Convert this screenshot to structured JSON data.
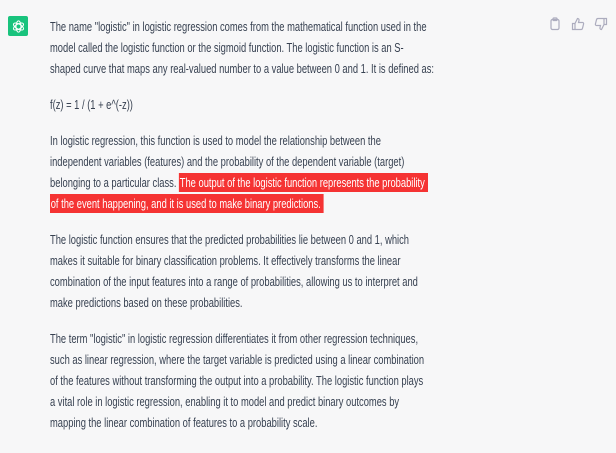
{
  "message": {
    "avatar_icon": "openai-logo-icon",
    "accent_color": "#19c37d",
    "highlight_color": "#f53333",
    "actions": [
      {
        "name": "copy-icon"
      },
      {
        "name": "thumbs-up-icon"
      },
      {
        "name": "thumbs-down-icon"
      }
    ],
    "p1": [
      "The name \"logistic\" in logistic regression comes from the mathematical function used in the",
      "model called the logistic function or the sigmoid function. The logistic function is an S-",
      "shaped curve that maps any real-valued number to a value between 0 and 1. It is defined as:"
    ],
    "formula": "f(z) = 1 / (1 + e^(-z))",
    "p2": [
      "In logistic regression, this function is used to model the relationship between the",
      "independent variables (features) and the probability of the dependent variable (target)"
    ],
    "p2_line3_plain": "belonging to a particular class. ",
    "p2_line3_highlight": "The output of the logistic function represents the probability",
    "p2_line4_highlight": "of the event happening, and it is used to make binary predictions.",
    "p3": [
      "The logistic function ensures that the predicted probabilities lie between 0 and 1, which",
      "makes it suitable for binary classification problems. It effectively transforms the linear",
      "combination of the input features into a range of probabilities, allowing us to interpret and",
      "make predictions based on these probabilities."
    ],
    "p4": [
      "The term \"logistic\" in logistic regression differentiates it from other regression techniques,",
      "such as linear regression, where the target variable is predicted using a linear combination",
      "of the features without transforming the output into a probability. The logistic function plays",
      "a vital role in logistic regression, enabling it to model and predict binary outcomes by",
      "mapping the linear combination of features to a probability scale."
    ]
  }
}
